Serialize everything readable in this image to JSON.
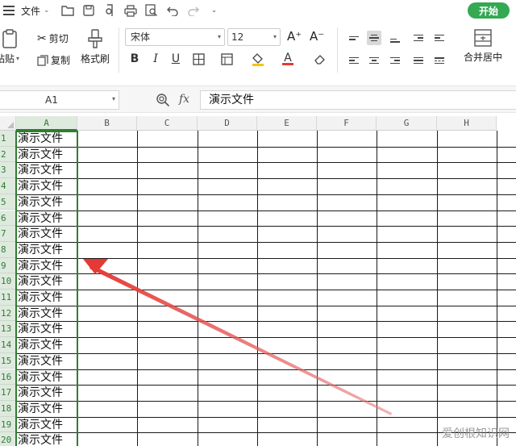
{
  "topbar": {
    "file_label": "文件",
    "start_tab": "开始"
  },
  "ribbon": {
    "paste_label": "粘贴",
    "cut_label": "剪切",
    "copy_label": "复制",
    "format_painter_label": "格式刷",
    "font_name": "宋体",
    "font_size": "12",
    "font_grow": "A⁺",
    "font_shrink": "A⁻",
    "bold": "B",
    "italic": "I",
    "underline": "U",
    "font_color_glyph": "A",
    "merge_label": "合并居中"
  },
  "formula_bar": {
    "name_box": "A1",
    "fx": "fx",
    "content": "演示文件"
  },
  "sheet": {
    "columns": [
      "A",
      "B",
      "C",
      "D",
      "E",
      "F",
      "G",
      "H"
    ],
    "rows": [
      "1",
      "2",
      "3",
      "4",
      "5",
      "6",
      "7",
      "8",
      "9",
      "10",
      "11",
      "12",
      "13",
      "14",
      "15",
      "16",
      "17",
      "18",
      "19",
      "20"
    ],
    "cell_text": "演示文件"
  },
  "watermark": "爱创根知识网",
  "colors": {
    "accent_green": "#2e7d32",
    "start_tab": "#34a853",
    "arrow": "#e53935"
  }
}
